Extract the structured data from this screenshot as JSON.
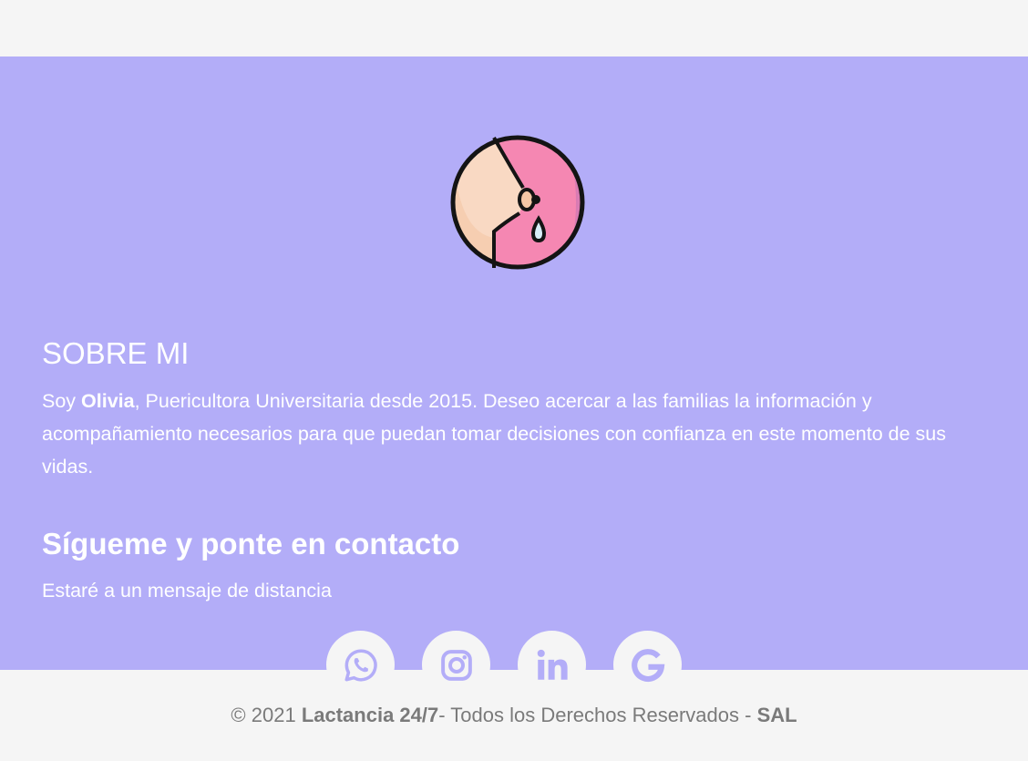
{
  "about": {
    "title": "SOBRE MI",
    "text_prefix": "Soy ",
    "name": "Olivia",
    "text_rest": ", Puericultora Universitaria desde 2015. Deseo acercar a las familias la información y acompañamiento necesarios para que puedan tomar decisiones con confianza en este momento de sus vidas."
  },
  "contact": {
    "title": "Sígueme y ponte en contacto",
    "subtitle": "Estaré a un mensaje de distancia"
  },
  "socials": [
    {
      "icon": "whatsapp-icon"
    },
    {
      "icon": "instagram-icon"
    },
    {
      "icon": "linkedin-icon"
    },
    {
      "icon": "google-icon"
    }
  ],
  "footer": {
    "copyright": "© 2021 ",
    "brand": "Lactancia 24/7",
    "rights": "- Todos los Derechos Reservados - ",
    "company": "SAL"
  },
  "colors": {
    "band_bg": "#b3adf8",
    "page_bg": "#f5f5f5",
    "icon_color": "#b3adf8",
    "logo_pink": "#f587b2",
    "logo_skin": "#f9d9c3"
  }
}
